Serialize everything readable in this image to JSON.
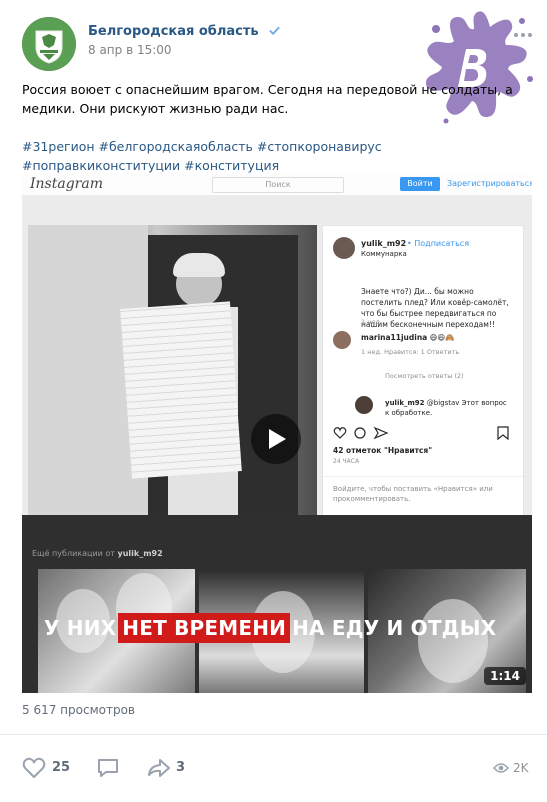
{
  "post": {
    "author": "Белгородская область",
    "date": "8 апр в 15:00",
    "text": "Россия воюет с опаснейшим врагом. Сегодня на передовой не солдаты, а медики. Они рискуют жизнью ради нас.",
    "hashtags": "#31регион #белгородскаяобласть #стопкоронавирус #поправкиконституции #конституция"
  },
  "media": {
    "instagram": {
      "logo": "Instagram",
      "search_placeholder": "Поиск",
      "login_button": "Войти",
      "register_link": "Зарегистрироваться",
      "username": "yulik_m92",
      "follow": "• Подписаться",
      "location": "Коммунарка",
      "comment_text": "Знаете что?) Ди... бы можно постелить плед? Или ковёр-самолёт, что бы быстрее передвигаться по нашим бесконечным переходам!!",
      "comment_meta": "1 нед.",
      "commenter2": "marina11judina",
      "commenter2_meta": "1 нед.  Нравится: 1  Ответить",
      "view_replies": "Посмотреть ответы (2)",
      "reply_user": "yulik_m92",
      "reply_text": "@bigstav Этот вопрос к обработке.",
      "likes": "42 отметок \"Нравится\"",
      "likes_date": "24 ЧАСА",
      "login_prompt": "Войдите, чтобы поставить «Нравится» или прокомментировать.",
      "more_from_prefix": "Ещё публикации от",
      "more_from_user": "yulik_m92"
    },
    "caption_before": "У НИХ",
    "caption_highlight": "НЕТ ВРЕМЕНИ",
    "caption_after": "НА ЕДУ И ОТДЫХ",
    "duration": "1:14"
  },
  "views_text": "5 617 просмотров",
  "actions": {
    "likes": "25",
    "shares": "3",
    "views": "2K"
  },
  "colors": {
    "link": "#2a5885",
    "muted": "#626d7a",
    "accent_red": "#d11a1a",
    "stamp_purple": "#8e74b8"
  }
}
